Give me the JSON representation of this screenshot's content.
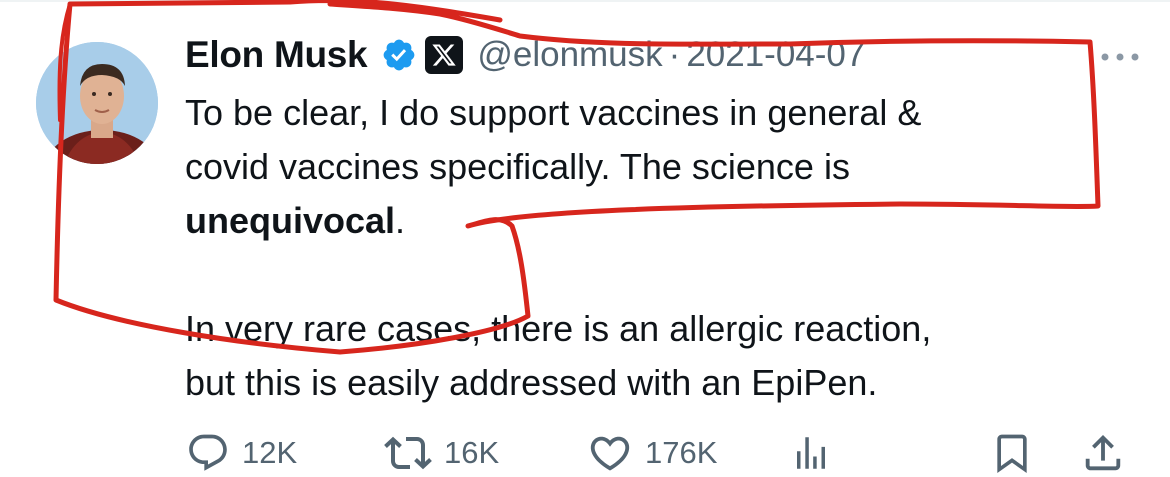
{
  "tweet": {
    "author_name": "Elon Musk",
    "handle": "@elonmusk",
    "separator": "·",
    "date": "2021-04-07",
    "body": {
      "line1": "To be clear, I do support vaccines in general &",
      "line2": "covid vaccines specifically. The science is",
      "bold_word": "unequivocal",
      "line3_suffix": ".",
      "para2_line1": "In very rare cases, there is an allergic reaction,",
      "para2_line2": "but this is easily addressed with an EpiPen."
    }
  },
  "actions": {
    "replies": {
      "icon": "reply-icon",
      "count": "12K"
    },
    "reposts": {
      "icon": "repost-icon",
      "count": "16K"
    },
    "likes": {
      "icon": "like-icon",
      "count": "176K"
    },
    "views": {
      "icon": "views-icon"
    },
    "bookmark": {
      "icon": "bookmark-icon"
    },
    "share": {
      "icon": "share-icon"
    }
  },
  "colors": {
    "text": "#0f1419",
    "secondary": "#536471",
    "verified_blue": "#1d9bf0",
    "annotation_red": "#d7261d"
  }
}
